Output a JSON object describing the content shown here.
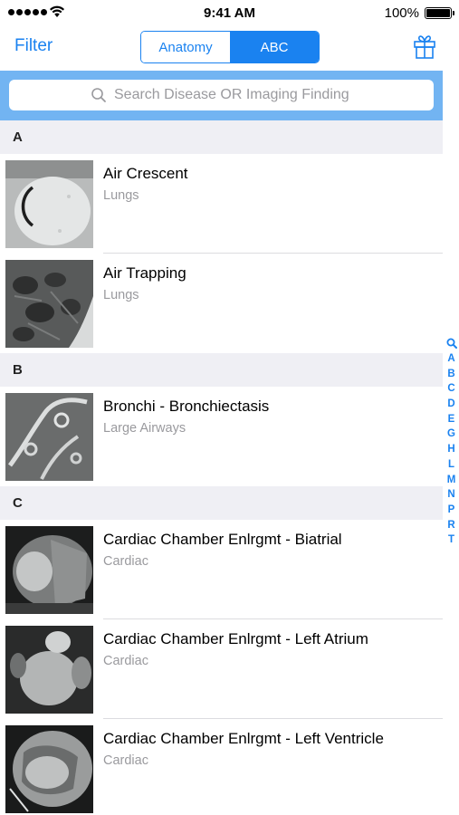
{
  "status_bar": {
    "time": "9:41 AM",
    "battery": "100%"
  },
  "nav": {
    "filter_label": "Filter",
    "segments": [
      {
        "label": "Anatomy",
        "selected": false
      },
      {
        "label": "ABC",
        "selected": true
      }
    ],
    "accent_color": "#1a82f0"
  },
  "search": {
    "placeholder": "Search Disease OR Imaging Finding"
  },
  "sections": [
    {
      "header": "A",
      "items": [
        {
          "title": "Air Crescent",
          "subtitle": "Lungs"
        },
        {
          "title": "Air Trapping",
          "subtitle": "Lungs"
        }
      ]
    },
    {
      "header": "B",
      "items": [
        {
          "title": "Bronchi - Bronchiectasis",
          "subtitle": "Large Airways"
        }
      ]
    },
    {
      "header": "C",
      "items": [
        {
          "title": "Cardiac Chamber Enlrgmt - Biatrial",
          "subtitle": "Cardiac"
        },
        {
          "title": "Cardiac Chamber Enlrgmt - Left Atrium",
          "subtitle": "Cardiac"
        },
        {
          "title": "Cardiac Chamber Enlrgmt - Left Ventricle",
          "subtitle": "Cardiac"
        }
      ]
    }
  ],
  "index": [
    "A",
    "B",
    "C",
    "D",
    "E",
    "G",
    "H",
    "L",
    "M",
    "N",
    "P",
    "R",
    "T"
  ]
}
